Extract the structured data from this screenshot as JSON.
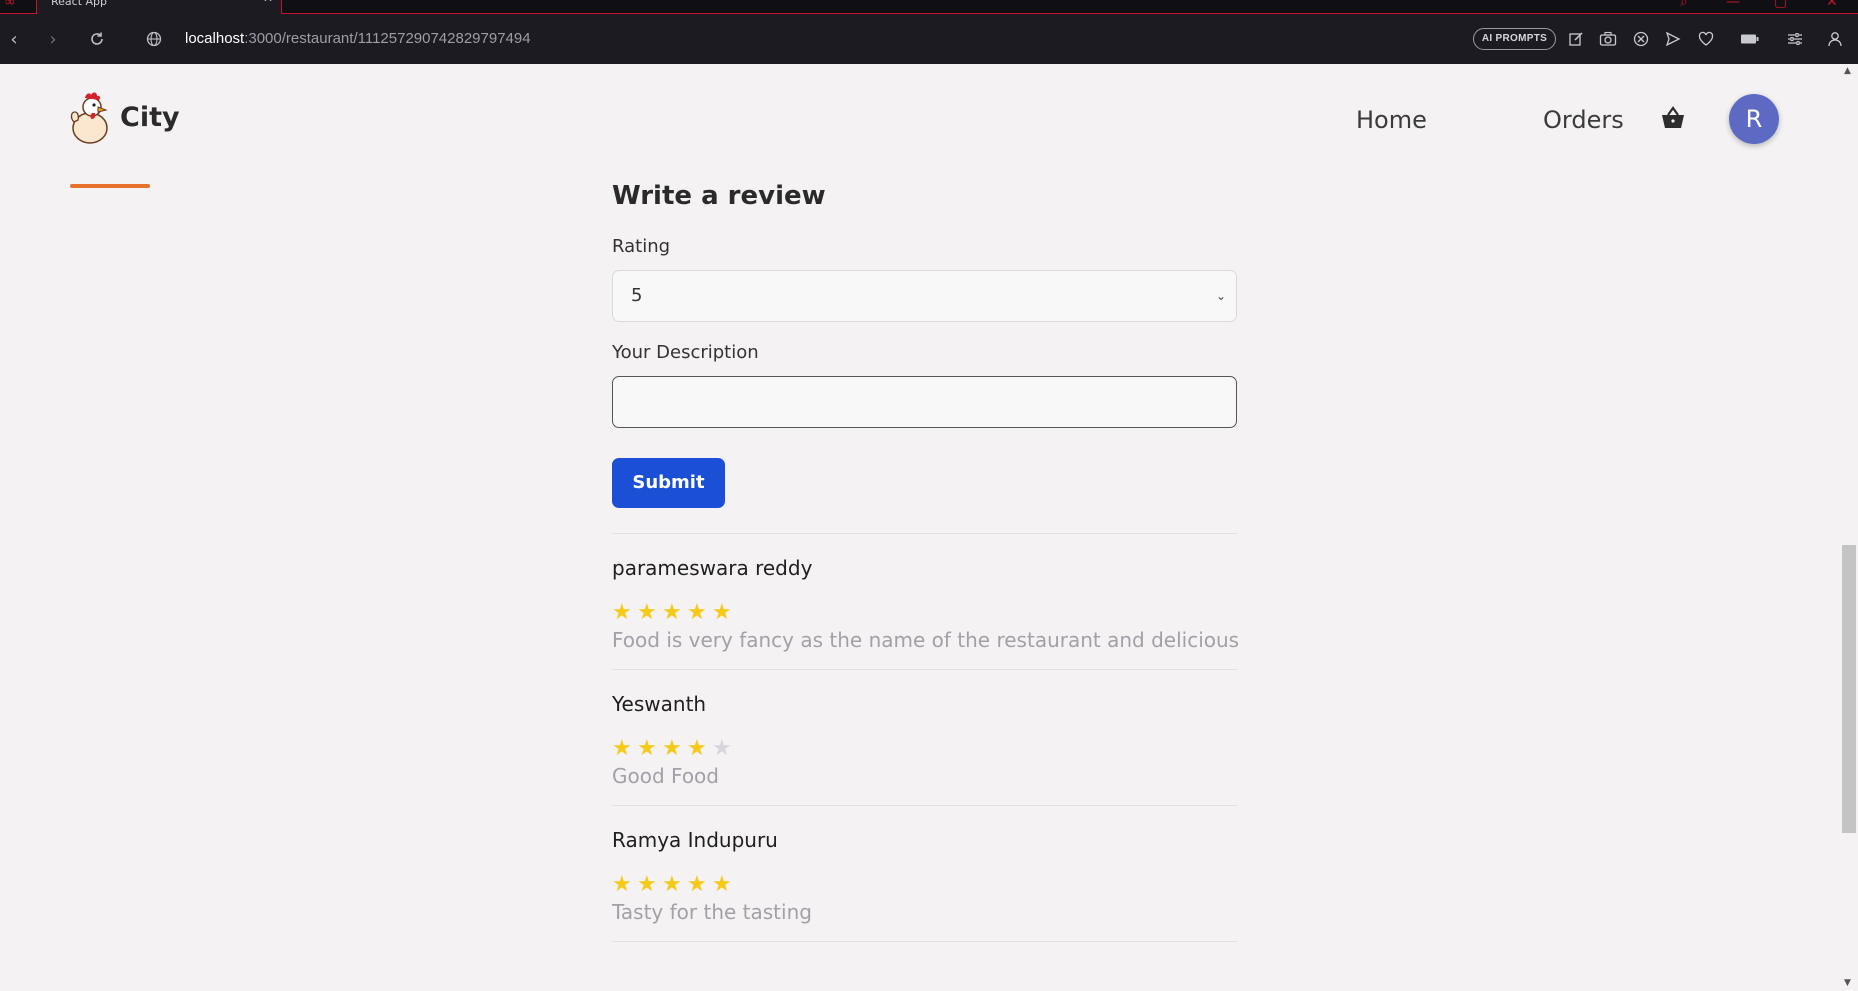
{
  "browser": {
    "tab_title": "React App",
    "url_host": "localhost",
    "url_path": ":3000/restaurant/111257290742829797494",
    "ai_prompts_label": "AI PROMPTS"
  },
  "header": {
    "brand": "City",
    "nav": {
      "home": "Home",
      "orders": "Orders"
    },
    "avatar_initial": "R",
    "accent_color": "#e8712c"
  },
  "review_form": {
    "title": "Write a review",
    "rating_label": "Rating",
    "rating_value": "5",
    "description_label": "Your Description",
    "description_value": "",
    "submit_label": "Submit"
  },
  "reviews": [
    {
      "name": "parameswara reddy",
      "rating": 5,
      "text": "Food is very fancy as the name of the restaurant and delicious"
    },
    {
      "name": "Yeswanth",
      "rating": 4,
      "text": "Good Food"
    },
    {
      "name": "Ramya Indupuru",
      "rating": 5,
      "text": "Tasty for the tasting"
    }
  ]
}
